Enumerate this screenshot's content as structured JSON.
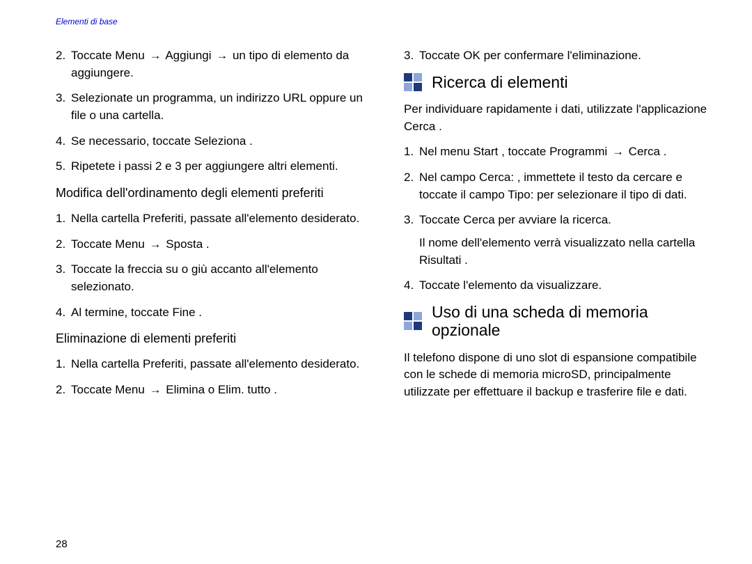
{
  "header": "Elementi di base",
  "page_number": "28",
  "left": {
    "steps_a": [
      {
        "n": "2.",
        "text_parts": [
          "Toccate Menu  ",
          "→",
          " Aggiungi   ",
          "→",
          " un tipo di elemento da aggiungere."
        ]
      },
      {
        "n": "3.",
        "text_parts": [
          "Selezionate un programma, un indirizzo URL oppure un file o una cartella."
        ]
      },
      {
        "n": "4.",
        "text_parts": [
          "Se necessario, toccate Seleziona  ."
        ]
      },
      {
        "n": "5.",
        "text_parts": [
          "Ripetete i passi 2 e 3 per aggiungere altri elementi."
        ]
      }
    ],
    "sub1": "Modifica dell'ordinamento degli elementi preferiti",
    "steps_b": [
      {
        "n": "1.",
        "text_parts": [
          "Nella cartella Preferiti, passate all'elemento desiderato."
        ]
      },
      {
        "n": "2.",
        "text_parts": [
          "Toccate Menu  ",
          "→",
          " Sposta  ."
        ]
      },
      {
        "n": "3.",
        "text_parts": [
          "Toccate la freccia su o giù accanto all'elemento selezionato."
        ]
      },
      {
        "n": "4.",
        "text_parts": [
          "Al termine, toccate Fine ."
        ]
      }
    ],
    "sub2": "Eliminazione di elementi preferiti",
    "steps_c": [
      {
        "n": "1.",
        "text_parts": [
          "Nella cartella Preferiti, passate all'elemento desiderato."
        ]
      },
      {
        "n": "2.",
        "text_parts": [
          "Toccate Menu  ",
          "→",
          " Elimina   o Elim. tutto    ."
        ]
      }
    ]
  },
  "right": {
    "steps_top": [
      {
        "n": "3.",
        "text_parts": [
          "Toccate OK  per confermare l'eliminazione."
        ]
      }
    ],
    "section1": "Ricerca di elementi",
    "para1": "Per individuare rapidamente i dati, utilizzate l'applicazione Cerca .",
    "steps_s1": [
      {
        "n": "1.",
        "text_parts": [
          "Nel menu Start , toccate Programmi    ",
          "→",
          " Cerca ."
        ]
      },
      {
        "n": "2.",
        "text_parts": [
          "Nel campo Cerca: , immettete il testo da cercare e toccate il campo Tipo:  per selezionare il tipo di dati."
        ]
      },
      {
        "n": "3.",
        "text_parts": [
          "Toccate Cerca  per avviare la ricerca."
        ],
        "after": "Il nome dell'elemento verrà visualizzato nella cartella Risultati    ."
      },
      {
        "n": "4.",
        "text_parts": [
          "Toccate l'elemento da visualizzare."
        ]
      }
    ],
    "section2": "Uso di una scheda di memoria opzionale",
    "para2": "Il telefono dispone di uno slot di espansione compatibile con le schede di memoria microSD, principalmente utilizzate per effettuare il backup e trasferire file e dati."
  }
}
